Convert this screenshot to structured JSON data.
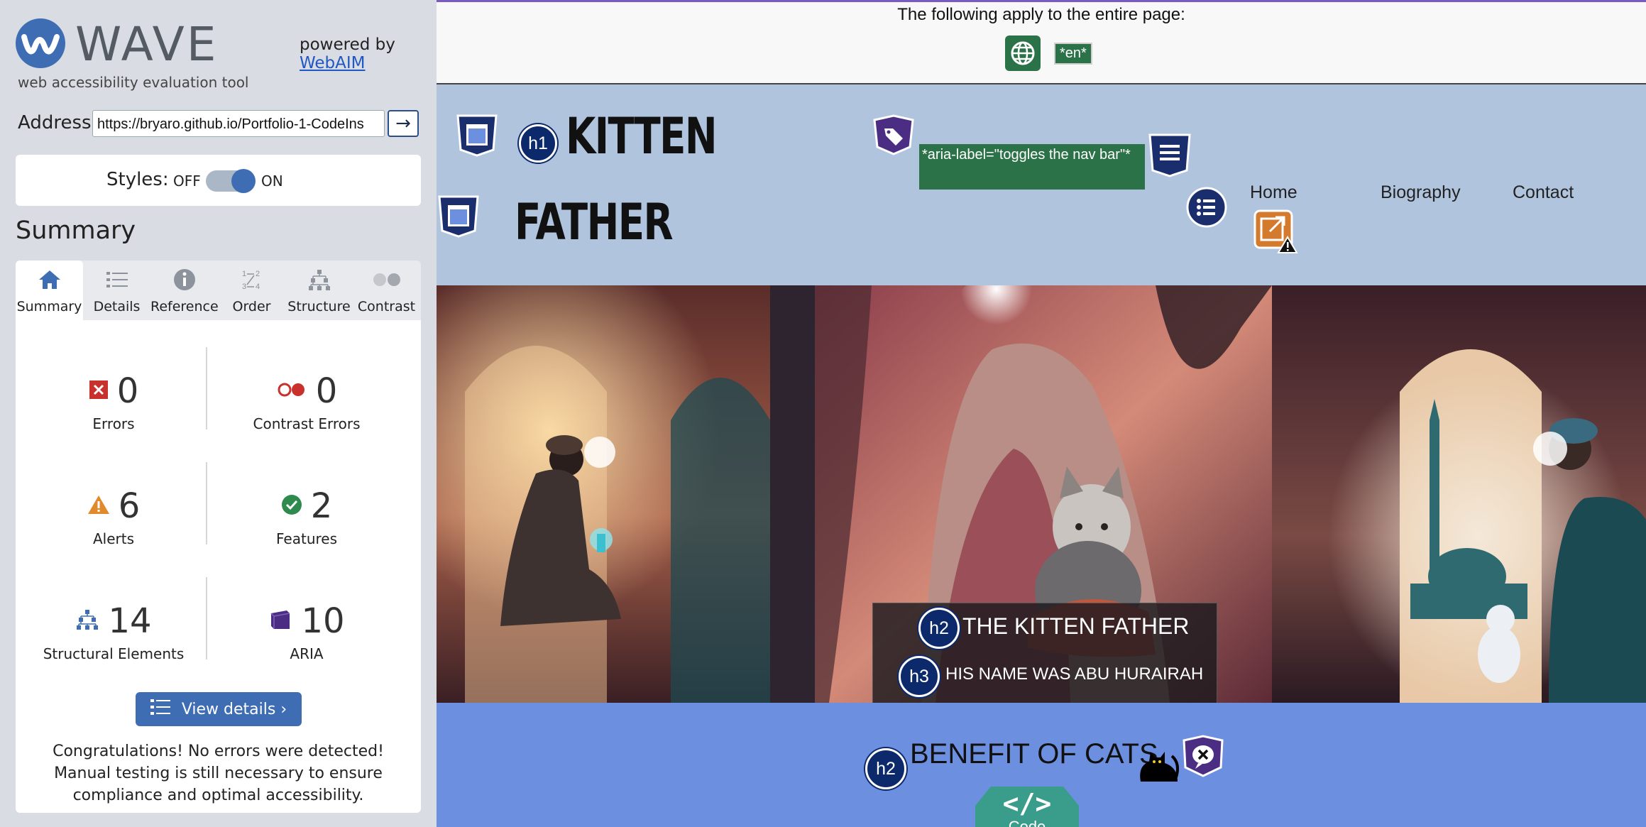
{
  "sidebar": {
    "logo_word": "WAVE",
    "logo_sub": "web accessibility evaluation tool",
    "powered_by": "powered by",
    "powered_link": "WebAIM",
    "address_label": "Address:",
    "address_value": "https://bryaro.github.io/Portfolio-1-CodeIns",
    "styles_label": "Styles:",
    "styles_off": "OFF",
    "styles_on": "ON",
    "summary_heading": "Summary",
    "tabs": [
      {
        "label": "Summary",
        "icon": "home-icon",
        "active": true
      },
      {
        "label": "Details",
        "icon": "list-icon"
      },
      {
        "label": "Reference",
        "icon": "info-icon"
      },
      {
        "label": "Order",
        "icon": "order-icon"
      },
      {
        "label": "Structure",
        "icon": "structure-icon"
      },
      {
        "label": "Contrast",
        "icon": "contrast-icon"
      }
    ],
    "stats": {
      "errors": {
        "value": "0",
        "label": "Errors"
      },
      "contrast_errors": {
        "value": "0",
        "label": "Contrast Errors"
      },
      "alerts": {
        "value": "6",
        "label": "Alerts"
      },
      "features": {
        "value": "2",
        "label": "Features"
      },
      "structural": {
        "value": "14",
        "label": "Structural Elements"
      },
      "aria": {
        "value": "10",
        "label": "ARIA"
      }
    },
    "view_details": "View details ›",
    "congrats": "Congratulations! No errors were detected! Manual testing is still necessary to ensure compliance and optimal accessibility."
  },
  "page": {
    "apply_text": "The following apply to the entire page:",
    "lang": "*en*",
    "title_line1": "KITTEN",
    "title_line2": "FATHER",
    "aria_label": "*aria-label=\"toggles the nav bar\"*",
    "nav": [
      "Home",
      "Biography",
      "Contact"
    ],
    "h1": "h1",
    "h2": "h2",
    "h3": "h3",
    "hero_h2": "THE KITTEN FATHER",
    "hero_h3": "HIS NAME WAS ABU HURAIRAH",
    "benefit_h2": "BENEFIT OF CATS",
    "code_label": "Code"
  },
  "colors": {
    "accent": "#3e6db4",
    "header_bg": "#b0c4de",
    "benefit_bg": "#6d8fe0",
    "aria_green": "#2c7248",
    "badge_navy": "#0c2a6b"
  }
}
